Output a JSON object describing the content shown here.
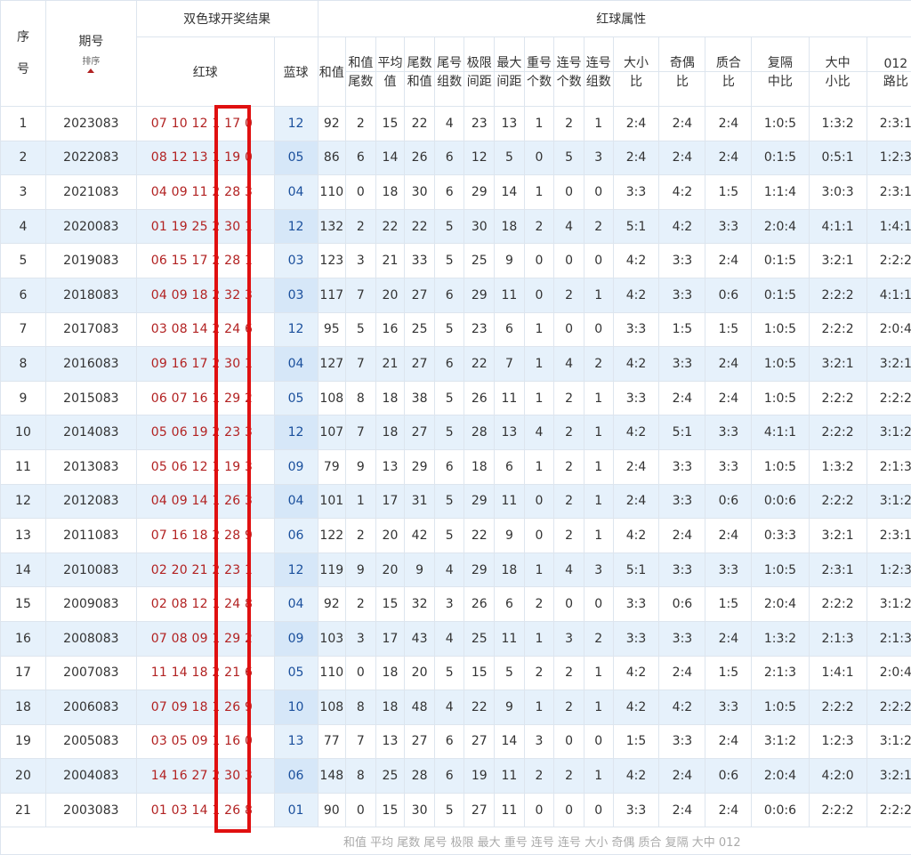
{
  "header": {
    "seq_top": "序",
    "seq_bottom": "号",
    "issue": "期号",
    "sort": "排序",
    "draw_results": "双色球开奖结果",
    "red_balls": "红球",
    "blue_ball": "蓝球",
    "red_attr": "红球属性",
    "cols": [
      "和值",
      "和值尾数",
      "平均值",
      "尾数和值",
      "尾号组数",
      "极限间距",
      "最大间距",
      "重号个数",
      "连号个数",
      "连号组数",
      "大小比",
      "奇偶比",
      "质合比",
      "复隔中比",
      "大中小比",
      "012路比"
    ]
  },
  "rows": [
    [
      "1",
      "2023083",
      "07 10 12 1 17 0",
      "12",
      "92",
      "2",
      "15",
      "22",
      "4",
      "23",
      "13",
      "1",
      "2",
      "1",
      "2:4",
      "2:4",
      "2:4",
      "1:0:5",
      "1:3:2",
      "2:3:1"
    ],
    [
      "2",
      "2022083",
      "08 12 13 1 19 0",
      "05",
      "86",
      "6",
      "14",
      "26",
      "6",
      "12",
      "5",
      "0",
      "5",
      "3",
      "2:4",
      "2:4",
      "2:4",
      "0:1:5",
      "0:5:1",
      "1:2:3"
    ],
    [
      "3",
      "2021083",
      "04 09 11 2 28 3",
      "04",
      "110",
      "0",
      "18",
      "30",
      "6",
      "29",
      "14",
      "1",
      "0",
      "0",
      "3:3",
      "4:2",
      "1:5",
      "1:1:4",
      "3:0:3",
      "2:3:1"
    ],
    [
      "4",
      "2020083",
      "01 19 25 2 30 1",
      "12",
      "132",
      "2",
      "22",
      "22",
      "5",
      "30",
      "18",
      "2",
      "4",
      "2",
      "5:1",
      "4:2",
      "3:3",
      "2:0:4",
      "4:1:1",
      "1:4:1"
    ],
    [
      "5",
      "2019083",
      "06 15 17 2 28 1",
      "03",
      "123",
      "3",
      "21",
      "33",
      "5",
      "25",
      "9",
      "0",
      "0",
      "0",
      "4:2",
      "3:3",
      "2:4",
      "0:1:5",
      "3:2:1",
      "2:2:2"
    ],
    [
      "6",
      "2018083",
      "04 09 18 2 32 3",
      "03",
      "117",
      "7",
      "20",
      "27",
      "6",
      "29",
      "11",
      "0",
      "2",
      "1",
      "4:2",
      "3:3",
      "0:6",
      "0:1:5",
      "2:2:2",
      "4:1:1"
    ],
    [
      "7",
      "2017083",
      "03 08 14 2 24 6",
      "12",
      "95",
      "5",
      "16",
      "25",
      "5",
      "23",
      "6",
      "1",
      "0",
      "0",
      "3:3",
      "1:5",
      "1:5",
      "1:0:5",
      "2:2:2",
      "2:0:4"
    ],
    [
      "8",
      "2016083",
      "09 16 17 2 30 1",
      "04",
      "127",
      "7",
      "21",
      "27",
      "6",
      "22",
      "7",
      "1",
      "4",
      "2",
      "4:2",
      "3:3",
      "2:4",
      "1:0:5",
      "3:2:1",
      "3:2:1"
    ],
    [
      "9",
      "2015083",
      "06 07 16 1 29 2",
      "05",
      "108",
      "8",
      "18",
      "38",
      "5",
      "26",
      "11",
      "1",
      "2",
      "1",
      "3:3",
      "2:4",
      "2:4",
      "1:0:5",
      "2:2:2",
      "2:2:2"
    ],
    [
      "10",
      "2014083",
      "05 06 19 2 23 3",
      "12",
      "107",
      "7",
      "18",
      "27",
      "5",
      "28",
      "13",
      "4",
      "2",
      "1",
      "4:2",
      "5:1",
      "3:3",
      "4:1:1",
      "2:2:2",
      "3:1:2"
    ],
    [
      "11",
      "2013083",
      "05 06 12 1 19 3",
      "09",
      "79",
      "9",
      "13",
      "29",
      "6",
      "18",
      "6",
      "1",
      "2",
      "1",
      "2:4",
      "3:3",
      "3:3",
      "1:0:5",
      "1:3:2",
      "2:1:3"
    ],
    [
      "12",
      "2012083",
      "04 09 14 1 26 3",
      "04",
      "101",
      "1",
      "17",
      "31",
      "5",
      "29",
      "11",
      "0",
      "2",
      "1",
      "2:4",
      "3:3",
      "0:6",
      "0:0:6",
      "2:2:2",
      "3:1:2"
    ],
    [
      "13",
      "2011083",
      "07 16 18 2 28 9",
      "06",
      "122",
      "2",
      "20",
      "42",
      "5",
      "22",
      "9",
      "0",
      "2",
      "1",
      "4:2",
      "2:4",
      "2:4",
      "0:3:3",
      "3:2:1",
      "2:3:1"
    ],
    [
      "14",
      "2010083",
      "02 20 21 2 23 1",
      "12",
      "119",
      "9",
      "20",
      "9",
      "4",
      "29",
      "18",
      "1",
      "4",
      "3",
      "5:1",
      "3:3",
      "3:3",
      "1:0:5",
      "2:3:1",
      "1:2:3"
    ],
    [
      "15",
      "2009083",
      "02 08 12 1 24 8",
      "04",
      "92",
      "2",
      "15",
      "32",
      "3",
      "26",
      "6",
      "2",
      "0",
      "0",
      "3:3",
      "0:6",
      "1:5",
      "2:0:4",
      "2:2:2",
      "3:1:2"
    ],
    [
      "16",
      "2008083",
      "07 08 09 1 29 2",
      "09",
      "103",
      "3",
      "17",
      "43",
      "4",
      "25",
      "11",
      "1",
      "3",
      "2",
      "3:3",
      "3:3",
      "2:4",
      "1:3:2",
      "2:1:3",
      "2:1:3"
    ],
    [
      "17",
      "2007083",
      "11 14 18 2 21 6",
      "05",
      "110",
      "0",
      "18",
      "20",
      "5",
      "15",
      "5",
      "2",
      "2",
      "1",
      "4:2",
      "2:4",
      "1:5",
      "2:1:3",
      "1:4:1",
      "2:0:4"
    ],
    [
      "18",
      "2006083",
      "07 09 18 1 26 9",
      "10",
      "108",
      "8",
      "18",
      "48",
      "4",
      "22",
      "9",
      "1",
      "2",
      "1",
      "4:2",
      "4:2",
      "3:3",
      "1:0:5",
      "2:2:2",
      "2:2:2"
    ],
    [
      "19",
      "2005083",
      "03 05 09 1 16 0",
      "13",
      "77",
      "7",
      "13",
      "27",
      "6",
      "27",
      "14",
      "3",
      "0",
      "0",
      "1:5",
      "3:3",
      "2:4",
      "3:1:2",
      "1:2:3",
      "3:1:2"
    ],
    [
      "20",
      "2004083",
      "14 16 27 2 30 3",
      "06",
      "148",
      "8",
      "25",
      "28",
      "6",
      "19",
      "11",
      "2",
      "2",
      "1",
      "4:2",
      "2:4",
      "0:6",
      "2:0:4",
      "4:2:0",
      "3:2:1"
    ],
    [
      "21",
      "2003083",
      "01 03 14 1 26 8",
      "01",
      "90",
      "0",
      "15",
      "30",
      "5",
      "27",
      "11",
      "0",
      "0",
      "0",
      "3:3",
      "2:4",
      "2:4",
      "0:0:6",
      "2:2:2",
      "2:2:2"
    ]
  ],
  "footer_partial": "和值 平均 尾数 尾号 极限 最大 重号 连号 连号  大小  奇偶  质合  复隔  大中  012",
  "colors": {
    "red_text": "#b22222",
    "blue_text": "#1a4f9c",
    "stripe": "#e6f1fb",
    "highlight_border": "#e01010"
  }
}
